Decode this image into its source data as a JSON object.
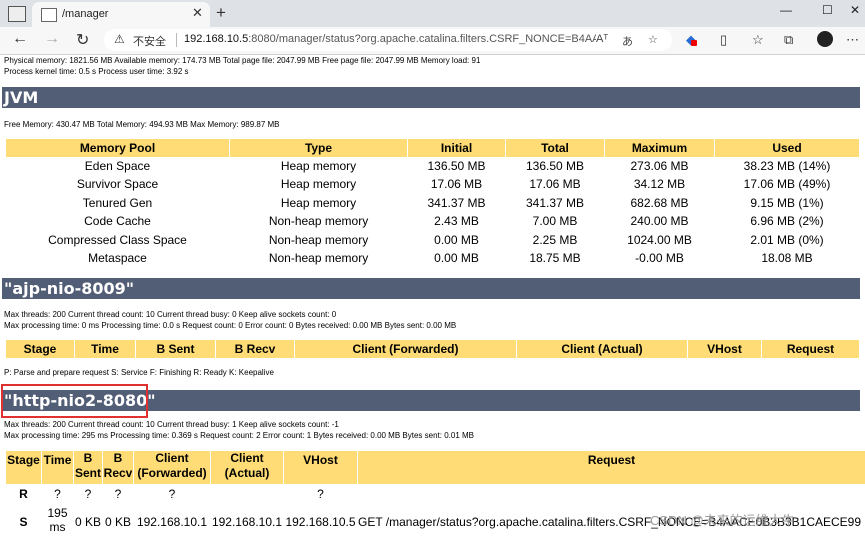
{
  "browser": {
    "tab_title": "/manager",
    "tab_close": "✕",
    "new_tab": "+",
    "window_min": "—",
    "window_max": "☐",
    "window_close": "✕",
    "back": "←",
    "forward": "→",
    "reload": "↻",
    "security_label": "不安全",
    "url_host": "192.168.10.5",
    "url_rest": ":8080/manager/status?org.apache.catalina.filters.CSRF_NONCE=B4AACE0...",
    "read_aloud": "Aᵀ",
    "translate": "あ"
  },
  "sysinfo": {
    "line1": "Physical memory: 1821.56 MB Available memory: 174.73 MB Total page file: 2047.99 MB Free page file: 2047.99 MB Memory load: 91",
    "line2": "Process kernel time: 0.5 s Process user time: 3.92 s"
  },
  "jvm": {
    "title": "JVM",
    "memory_line": "Free Memory: 430.47 MB Total Memory: 494.93 MB Max Memory: 989.87 MB",
    "headers": [
      "Memory Pool",
      "Type",
      "Initial",
      "Total",
      "Maximum",
      "Used"
    ],
    "rows": [
      [
        "Eden Space",
        "Heap memory",
        "136.50 MB",
        "136.50 MB",
        "273.06 MB",
        "38.23 MB (14%)"
      ],
      [
        "Survivor Space",
        "Heap memory",
        "17.06 MB",
        "17.06 MB",
        "34.12 MB",
        "17.06 MB (49%)"
      ],
      [
        "Tenured Gen",
        "Heap memory",
        "341.37 MB",
        "341.37 MB",
        "682.68 MB",
        "9.15 MB (1%)"
      ],
      [
        "Code Cache",
        "Non-heap memory",
        "2.43 MB",
        "7.00 MB",
        "240.00 MB",
        "6.96 MB (2%)"
      ],
      [
        "Compressed Class Space",
        "Non-heap memory",
        "0.00 MB",
        "2.25 MB",
        "1024.00 MB",
        "2.01 MB (0%)"
      ],
      [
        "Metaspace",
        "Non-heap memory",
        "0.00 MB",
        "18.75 MB",
        "-0.00 MB",
        "18.08 MB"
      ]
    ]
  },
  "ajp": {
    "title": "\"ajp-nio-8009\"",
    "line1": "Max threads: 200 Current thread count: 10 Current thread busy: 0 Keep alive sockets count: 0",
    "line2": "Max processing time: 0 ms Processing time: 0.0 s Request count: 0 Error count: 0 Bytes received: 0.00 MB Bytes sent: 0.00 MB",
    "headers": [
      "Stage",
      "Time",
      "B Sent",
      "B Recv",
      "Client (Forwarded)",
      "Client (Actual)",
      "VHost",
      "Request"
    ],
    "legend": "P: Parse and prepare request S: Service F: Finishing R: Ready K: Keepalive"
  },
  "http": {
    "title": "\"http-nio2-8080\"",
    "line1": "Max threads: 200 Current thread count: 10 Current thread busy: 1 Keep alive sockets count: -1",
    "line2": "Max processing time: 295 ms Processing time: 0.369 s Request count: 2 Error count: 1 Bytes received: 0.00 MB Bytes sent: 0.01 MB",
    "headers": {
      "stage": "Stage",
      "time": "Time",
      "bsent": "B Sent",
      "brecv": "B Recv",
      "cfwd": "Client (Forwarded)",
      "cact": "Client (Actual)",
      "vhost": "VHost",
      "request": "Request"
    },
    "row_r": {
      "stage": "R",
      "time": "?",
      "bsent": "?",
      "brecv": "?",
      "cfwd": "?",
      "vhost": "?"
    },
    "row_s": {
      "stage": "S",
      "time": "195 ms",
      "bsent": "0 KB",
      "brecv": "0 KB",
      "cfwd": "192.168.10.1",
      "cact": "192.168.10.1",
      "vhost": "192.168.10.5",
      "request": "GET /manager/status?org.apache.catalina.filters.CSRF_NONCE=B4AACE0B3B3B1CAECE99"
    }
  },
  "watermark": "CSDN @未来的运维大牛"
}
